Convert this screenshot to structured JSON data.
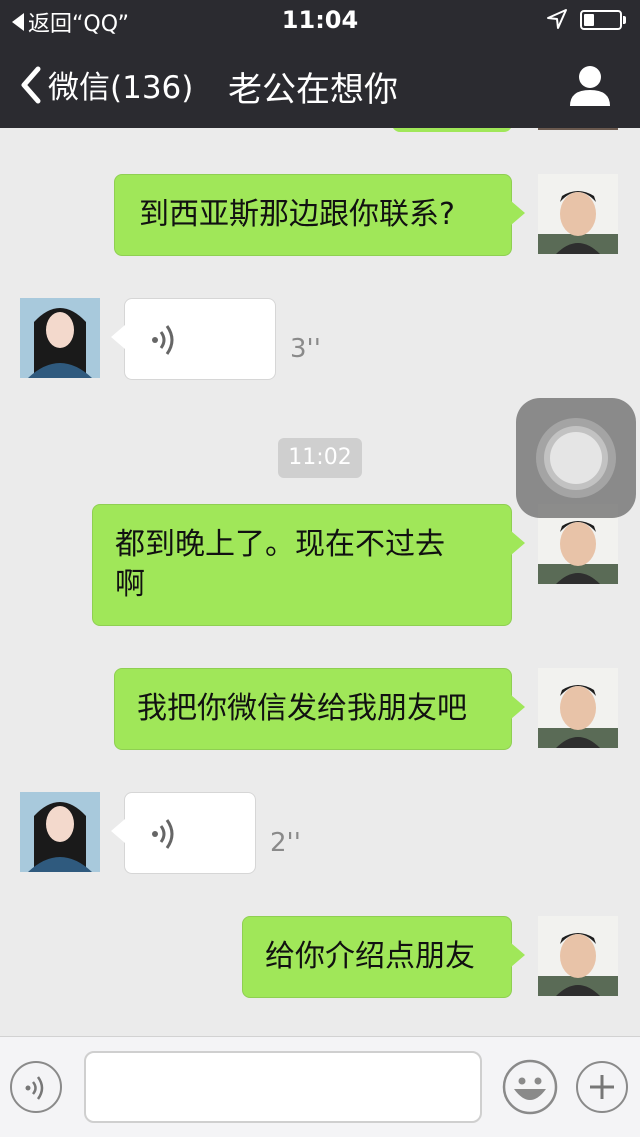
{
  "status_bar": {
    "back_app": "返回“QQ”",
    "time": "11:04"
  },
  "nav": {
    "back_label": "微信(136)",
    "title": "老公在想你"
  },
  "messages": [
    {
      "side": "right",
      "text": "到西亚斯那边跟你联系?"
    },
    {
      "side": "left",
      "type": "voice",
      "duration": "3''"
    },
    {
      "side": "right",
      "text": "都到晚上了。现在不过去"
    },
    {
      "side": "right",
      "text": "啊"
    },
    {
      "side": "right",
      "text": "我把你微信发给我朋友吧"
    },
    {
      "side": "left",
      "type": "voice",
      "duration": "2''"
    },
    {
      "side": "right",
      "text": "给你介绍点朋友"
    }
  ],
  "timestamp": "11:02",
  "input": {
    "placeholder": "",
    "value": ""
  },
  "colors": {
    "header_bg": "#2b2b30",
    "bubble_green": "#a0e759",
    "chat_bg": "#ebebeb"
  },
  "icons": [
    "back-arrow-icon",
    "profile-icon",
    "voice-icon",
    "emoji-icon",
    "plus-icon",
    "location-arrow-icon",
    "battery-icon"
  ]
}
